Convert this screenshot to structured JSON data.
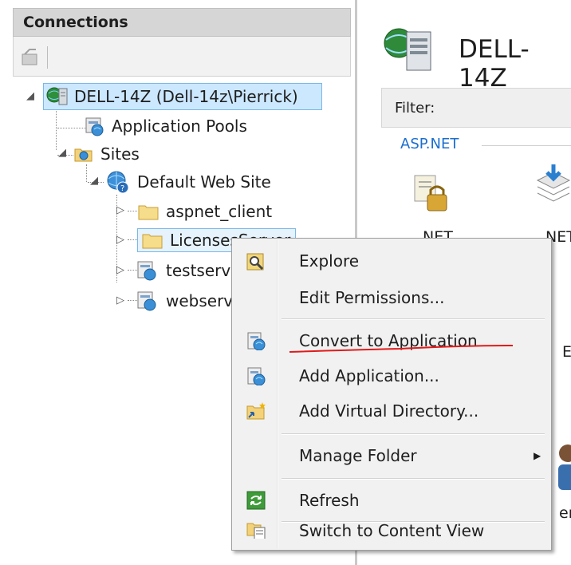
{
  "connections": {
    "title": "Connections",
    "tree": {
      "server": "DELL-14Z (Dell-14z\\Pierrick)",
      "app_pools": "Application Pools",
      "sites": "Sites",
      "default_site": "Default Web Site",
      "children": [
        "aspnet_client",
        "LicensesServer",
        "testserve",
        "webserv"
      ]
    }
  },
  "content": {
    "server_title": "DELL-14Z",
    "filter_label": "Filter:",
    "group_label": "ASP.NET",
    "features": [
      ".NET",
      ".NET",
      "E",
      "en"
    ]
  },
  "context_menu": {
    "items": [
      {
        "label": "Explore",
        "icon": "explore-icon"
      },
      {
        "label": "Edit Permissions...",
        "icon": ""
      },
      {
        "label": "Convert to Application",
        "icon": "convert-app-icon"
      },
      {
        "label": "Add Application...",
        "icon": "add-app-icon"
      },
      {
        "label": "Add Virtual Directory...",
        "icon": "add-vdir-icon"
      },
      {
        "label": "Manage Folder",
        "icon": ""
      },
      {
        "label": "Refresh",
        "icon": "refresh-icon"
      },
      {
        "label": "Switch to Content View",
        "icon": "content-view-icon"
      }
    ],
    "submenu_arrow": "▶"
  },
  "colors": {
    "selection": "#cce8ff",
    "annotation": "#e11b1b",
    "group_label": "#1a6fcf"
  }
}
